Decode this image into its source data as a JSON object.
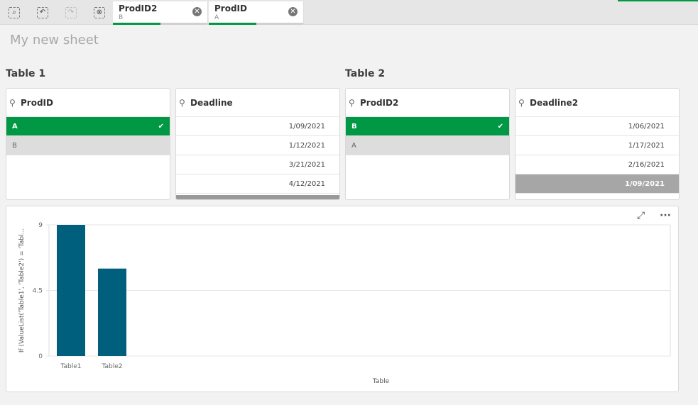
{
  "toolbar": {
    "tools": [
      {
        "icon": "smart-search-icon"
      },
      {
        "icon": "step-back-icon"
      },
      {
        "icon": "step-forward-icon"
      },
      {
        "icon": "clear-selections-icon"
      }
    ]
  },
  "selections": [
    {
      "field": "ProdID2",
      "value": "B"
    },
    {
      "field": "ProdID",
      "value": "A"
    }
  ],
  "sheet": {
    "title": "My new sheet"
  },
  "table1": {
    "label": "Table 1",
    "prodid": {
      "title": "ProdID",
      "rows": [
        {
          "v": "A",
          "state": "selected"
        },
        {
          "v": "B",
          "state": "alternative"
        }
      ]
    },
    "deadline": {
      "title": "Deadline",
      "rows": [
        "1/09/2021",
        "1/12/2021",
        "3/21/2021",
        "4/12/2021"
      ]
    }
  },
  "table2": {
    "label": "Table 2",
    "prodid": {
      "title": "ProdID2",
      "rows": [
        {
          "v": "B",
          "state": "selected"
        },
        {
          "v": "A",
          "state": "alternative"
        }
      ]
    },
    "deadline": {
      "title": "Deadline2",
      "rows": [
        "1/06/2021",
        "1/17/2021",
        "2/16/2021",
        "1/09/2021"
      ]
    }
  },
  "colors": {
    "selected": "#009845",
    "bar": "#005f7c"
  },
  "chart_data": {
    "type": "bar",
    "categories": [
      "Table1",
      "Table2"
    ],
    "values": [
      9,
      6
    ],
    "xlabel": "Table",
    "ylabel": "If (ValueList('Table1', 'Table2') = 'Tabl...",
    "yticks": [
      "0",
      "4.5",
      "9"
    ],
    "ylim": [
      0,
      9
    ],
    "grid": true
  }
}
